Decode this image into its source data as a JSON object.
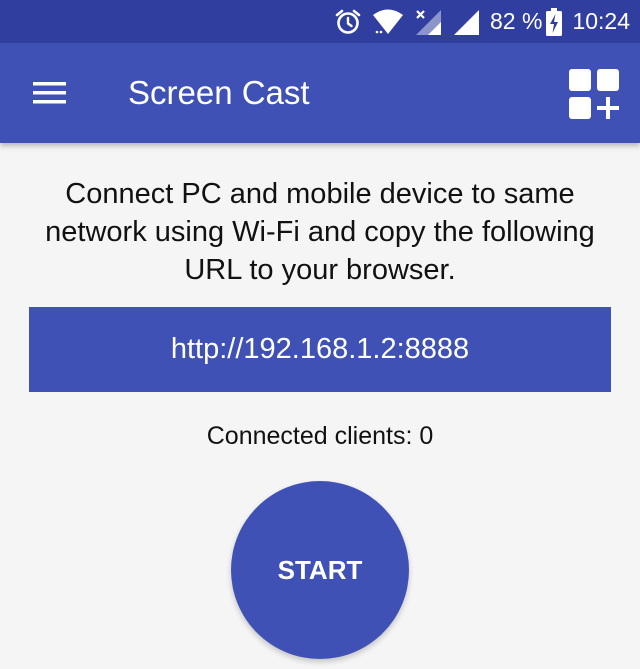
{
  "status_bar": {
    "battery_text": "82 %",
    "time": "10:24",
    "icons": [
      "alarm-icon",
      "wifi-icon",
      "signal-no-sim-icon",
      "signal-icon",
      "battery-charging-icon"
    ]
  },
  "app_bar": {
    "title": "Screen Cast",
    "menu_icon": "hamburger-menu-icon",
    "action_icon": "add-widget-icon"
  },
  "main": {
    "instructions": "Connect PC and mobile device to same network using Wi-Fi and copy the following URL to your browser.",
    "url": "http://192.168.1.2:8888",
    "connected_clients_text": "Connected clients: 0",
    "start_label": "START"
  },
  "colors": {
    "status_bar": "#303f9f",
    "primary": "#3f51b5",
    "background": "#f5f5f5",
    "text": "#111111"
  }
}
